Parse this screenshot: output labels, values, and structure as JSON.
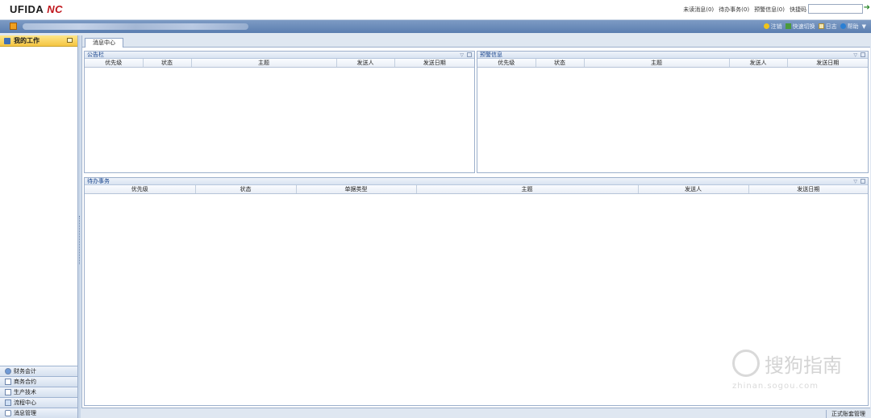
{
  "app": {
    "logo_text": "UFIDA",
    "logo_mark": "NC"
  },
  "header": {
    "links": [
      "未读消息(0)",
      "待办事务(0)",
      "预警信息(0)",
      "快捷码"
    ],
    "quick_code_value": "",
    "go_icon": "arrow-right-icon"
  },
  "navbar": {
    "actions": [
      {
        "label": "注销",
        "icon": "key-icon"
      },
      {
        "label": "快速切换",
        "icon": "switch-icon"
      },
      {
        "label": "日志",
        "icon": "log-icon"
      },
      {
        "label": "帮助",
        "icon": "help-icon"
      }
    ]
  },
  "sidebar": {
    "title": "我的工作",
    "modules": [
      {
        "label": "财务会计",
        "icon": "finance-icon"
      },
      {
        "label": "商务合约",
        "icon": "contract-icon"
      },
      {
        "label": "生产技术",
        "icon": "production-icon"
      },
      {
        "label": "流程中心",
        "icon": "workflow-icon"
      },
      {
        "label": "消息管理",
        "icon": "message-icon"
      }
    ]
  },
  "main": {
    "tab": "消息中心",
    "panels": {
      "notice": {
        "title": "公告栏",
        "columns": [
          "优先级",
          "状态",
          "主题",
          "发送人",
          "发送日期"
        ]
      },
      "alert": {
        "title": "预警信息",
        "columns": [
          "优先级",
          "状态",
          "主题",
          "发送人",
          "发送日期"
        ]
      },
      "todo": {
        "title": "待办事务",
        "columns": [
          "优先级",
          "状态",
          "单据类型",
          "主题",
          "发送人",
          "发送日期"
        ]
      }
    }
  },
  "statusbar": {
    "text": "正式账套管理"
  },
  "watermark": {
    "title": "搜狗指南",
    "sub": "zhinan.sogou.com"
  },
  "colors": {
    "accent": "#5b7eb0",
    "sidebar_head": "#f5c542",
    "brand_red": "#c0161c"
  }
}
